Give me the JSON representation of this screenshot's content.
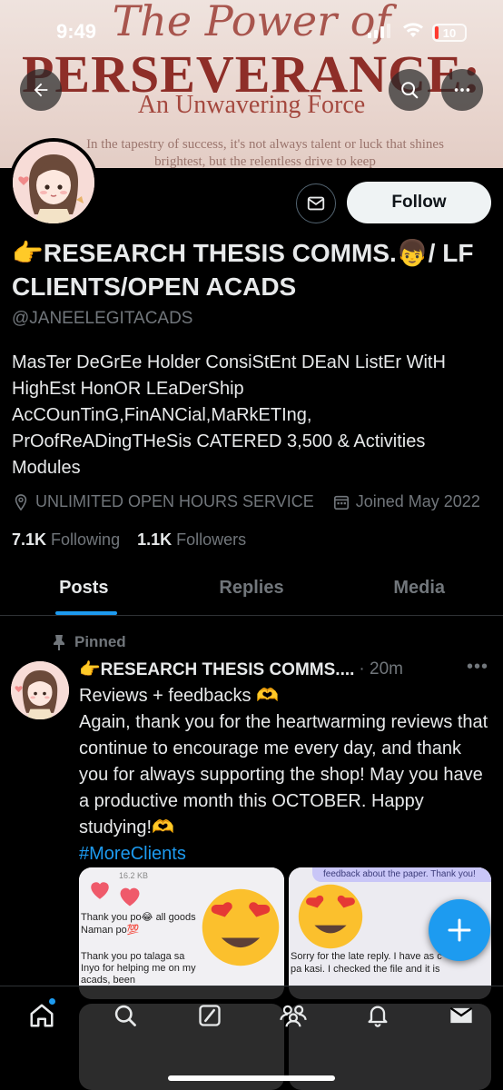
{
  "status_bar": {
    "time": "9:49",
    "battery": "10"
  },
  "banner": {
    "line1": "The Power of",
    "line2": "PERSEVERANCE:",
    "line3": "An Unwavering Force",
    "line4": "In the tapestry of success, it's not always talent or luck that shines brightest, but the relentless drive to keep"
  },
  "profile": {
    "follow_label": "Follow",
    "name": "👉RESEARCH THESIS COMMS.👦/ LF CLIENTS/OPEN ACADS",
    "handle": "@JANEELEGITACADS",
    "bio": "MasTer DeGrEe Holder ConsiStEnt DEaN ListEr WitH HighEst HonOR LEaDerShip AcCOunTinG,FinANCial,MaRkETIng, PrOofReADingTHeSis CATERED 3,500 & Activities Modules",
    "location": "UNLIMITED OPEN HOURS SERVICE",
    "joined": "Joined May 2022",
    "following_count": "7.1K",
    "following_label": "Following",
    "followers_count": "1.1K",
    "followers_label": "Followers"
  },
  "tabs": [
    {
      "label": "Posts"
    },
    {
      "label": "Replies"
    },
    {
      "label": "Media"
    }
  ],
  "post": {
    "pinned_label": "Pinned",
    "author": "👉RESEARCH THESIS COMMS....",
    "time": "· 20m",
    "line1": "Reviews + feedbacks 🫶",
    "text": "Again, thank you for the heartwarming reviews that continue to encourage me every day, and thank you for always supporting the shop! May you have a productive month this OCTOBER. Happy studying!🫶",
    "hashtag": "#MoreClients"
  },
  "media": {
    "img1_size": "16.2 KB",
    "img1_line1": "Thank you po😂 all goods",
    "img1_line2": "Naman po💯",
    "img1_line3": "Thank you po talaga sa Inyo for helping me on my acads, been",
    "img2_top": "feedback about the paper. Thank you!",
    "img2_line1": "Sorry for the late reply. I have as c",
    "img2_line2": "pa kasi. I checked the file and it is"
  },
  "colors": {
    "accent": "#1d9bf0",
    "background": "#000000",
    "muted": "#71767b"
  }
}
